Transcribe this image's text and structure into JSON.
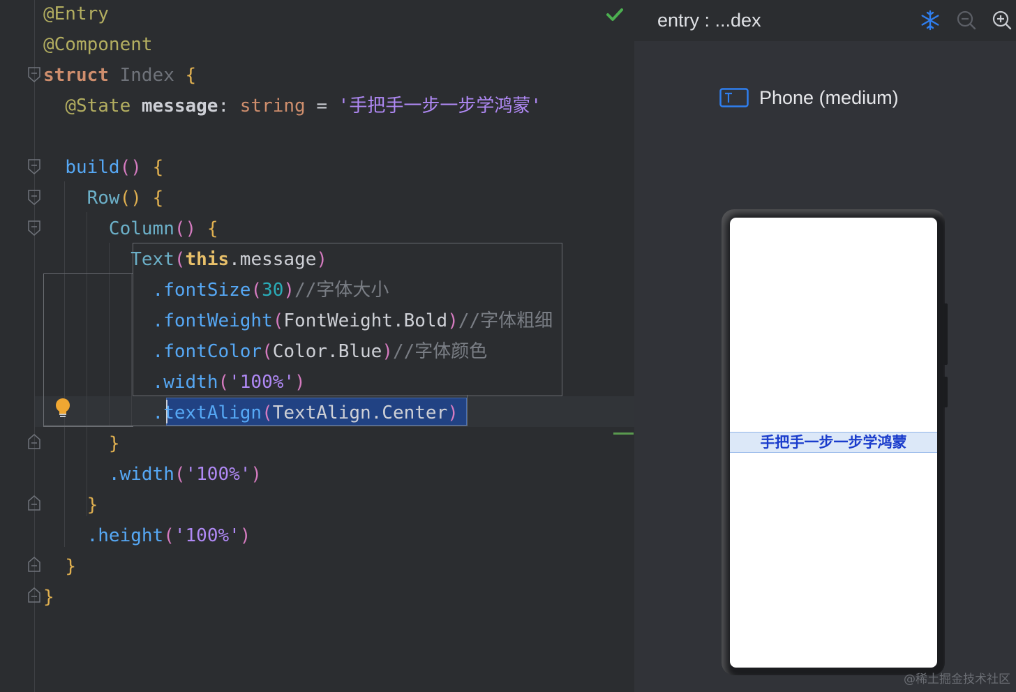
{
  "editor": {
    "lines": [
      "@Entry",
      "@Component",
      "struct",
      "Index",
      "@State",
      "message",
      "string",
      "'手把手一步一步学鸿蒙'",
      "build",
      "Row",
      "Column",
      "Text",
      "this",
      "message",
      ".fontSize",
      "30",
      "//字体大小",
      ".fontWeight",
      "FontWeight",
      "Bold",
      "//字体粗细",
      ".fontColor",
      "Color",
      "Blue",
      "//字体颜色",
      ".width",
      "'100%'",
      ".textAlign",
      "TextAlign",
      "Center",
      ".height"
    ],
    "status_icon": "check-icon",
    "intention_icon": "lightbulb-icon"
  },
  "preview": {
    "title": "entry : ...dex",
    "toolbar_icons": [
      "snowflake-icon",
      "zoom-out-icon",
      "zoom-in-icon"
    ],
    "device_label": "Phone (medium)",
    "device_icon": "text-device-icon",
    "screen_text": "手把手一步一步学鸿蒙",
    "accent_color": "#2f7ff0",
    "text_color": "#1a3ccc"
  },
  "watermark": "@稀土掘金技术社区"
}
